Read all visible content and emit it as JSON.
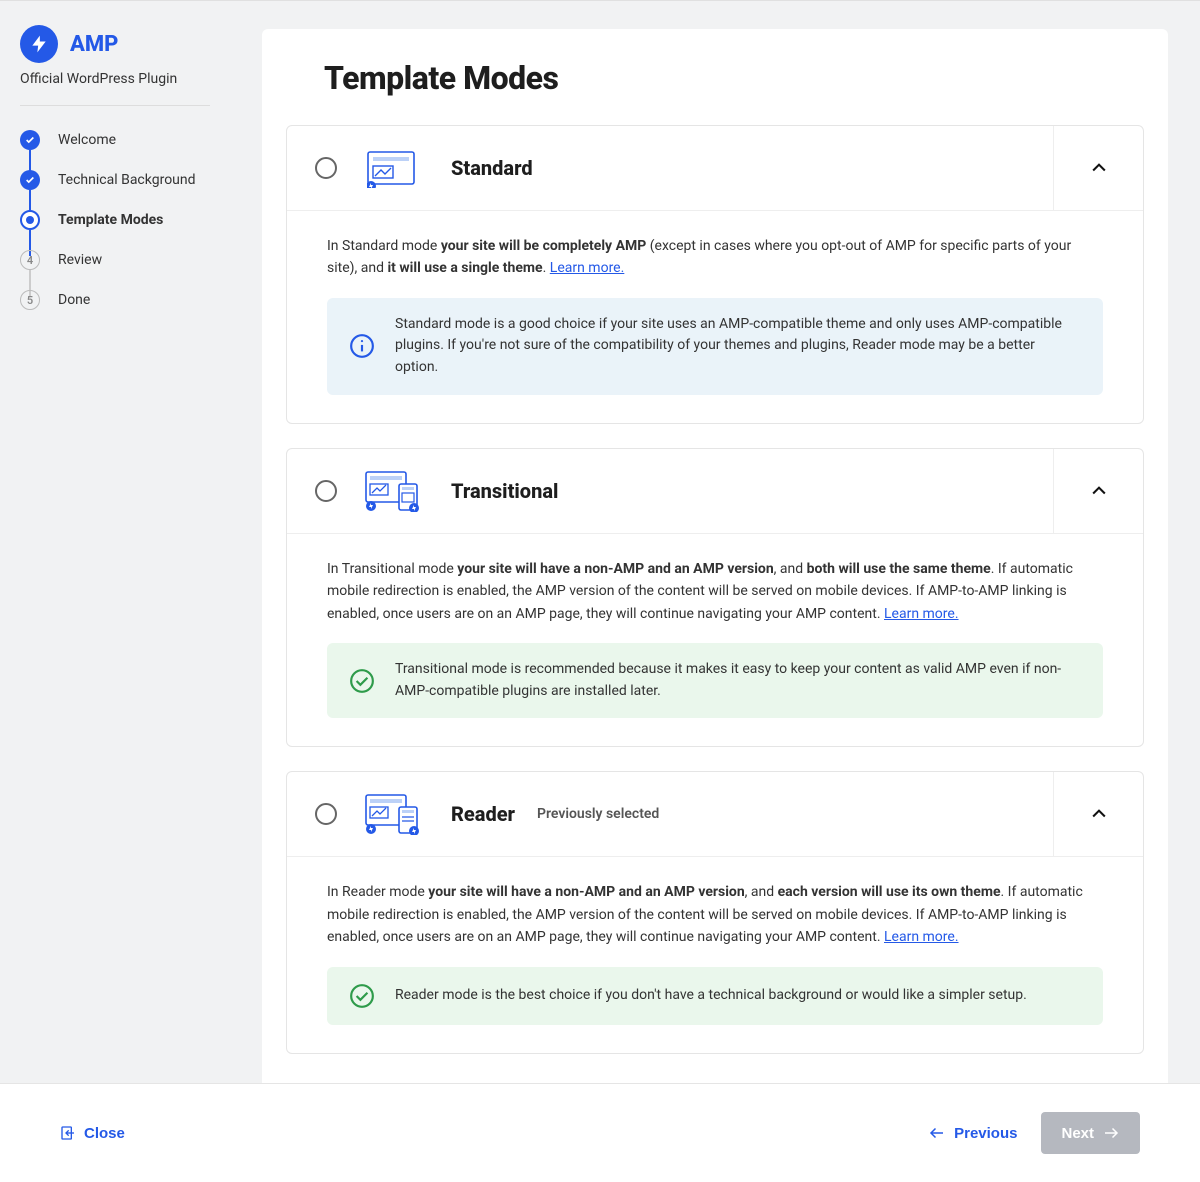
{
  "brand": {
    "title": "AMP",
    "subtitle": "Official WordPress Plugin"
  },
  "steps": [
    {
      "label": "Welcome",
      "state": "done"
    },
    {
      "label": "Technical Background",
      "state": "done"
    },
    {
      "label": "Template Modes",
      "state": "active"
    },
    {
      "label": "Review",
      "state": "pending",
      "num": "4"
    },
    {
      "label": "Done",
      "state": "pending",
      "num": "5"
    }
  ],
  "page": {
    "title": "Template Modes"
  },
  "modes": {
    "standard": {
      "title": "Standard",
      "desc_prefix": "In Standard mode ",
      "desc_b1": "your site will be completely AMP",
      "desc_mid": " (except in cases where you opt-out of AMP for specific parts of your site), and ",
      "desc_b2": "it will use a single theme",
      "desc_suffix": ". ",
      "learn": "Learn more.",
      "callout": "Standard mode is a good choice if your site uses an AMP-compatible theme and only uses AMP-compatible plugins. If you're not sure of the compatibility of your themes and plugins, Reader mode may be a better option."
    },
    "transitional": {
      "title": "Transitional",
      "desc_prefix": "In Transitional mode ",
      "desc_b1": "your site will have a non-AMP and an AMP version",
      "desc_mid": ", and ",
      "desc_b2": "both will use the same theme",
      "desc_suffix": ". If automatic mobile redirection is enabled, the AMP version of the content will be served on mobile devices. If AMP-to-AMP linking is enabled, once users are on an AMP page, they will continue navigating your AMP content. ",
      "learn": "Learn more.",
      "callout": "Transitional mode is recommended because it makes it easy to keep your content as valid AMP even if non-AMP-compatible plugins are installed later."
    },
    "reader": {
      "title": "Reader",
      "badge": "Previously selected",
      "desc_prefix": "In Reader mode ",
      "desc_b1": "your site will have a non-AMP and an AMP version",
      "desc_mid": ", and ",
      "desc_b2": "each version will use its own theme",
      "desc_suffix": ". If automatic mobile redirection is enabled, the AMP version of the content will be served on mobile devices. If AMP-to-AMP linking is enabled, once users are on an AMP page, they will continue navigating your AMP content. ",
      "learn": "Learn more.",
      "callout": "Reader mode is the best choice if you don't have a technical background or would like a simpler setup."
    }
  },
  "footer": {
    "close": "Close",
    "prev": "Previous",
    "next": "Next"
  }
}
